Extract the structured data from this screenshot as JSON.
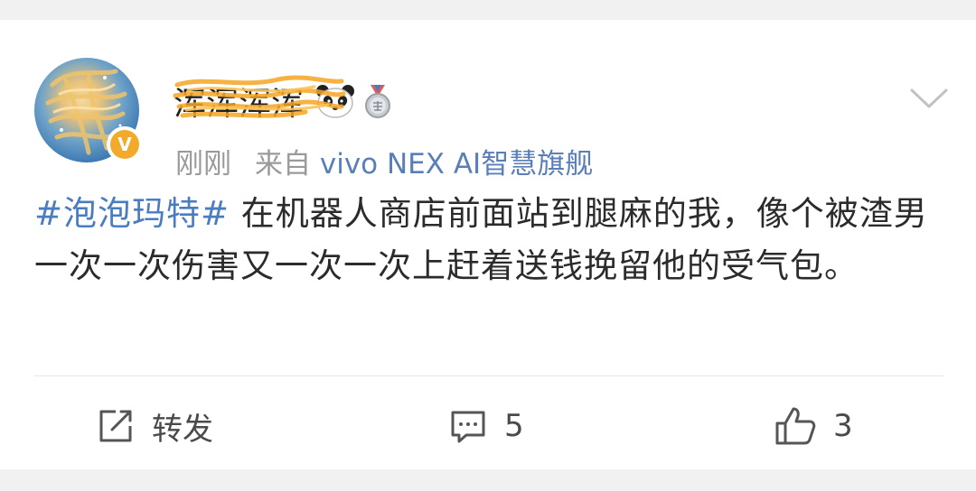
{
  "post": {
    "user": {
      "name": "浑浑浑浑",
      "avatar_icon": "avatar-image",
      "verified_icon": "verified-v-icon",
      "verified_mark": "V",
      "badges": [
        "panda-icon",
        "medal-icon"
      ]
    },
    "time": "刚刚",
    "source_prefix": "来自",
    "source_device": "vivo NEX AI智慧旗舰",
    "hashtag": "#泡泡玛特#",
    "body": " 在机器人商店前面站到腿麻的我，像个被渣男一次一次伤害又一次一次上赶着送钱挽留他的受气包。"
  },
  "actions": {
    "repost_label": "转发",
    "comment_count": "5",
    "like_count": "3"
  },
  "colors": {
    "hashtag": "#4a7cc1",
    "verified": "#f3a92a",
    "meta_text": "#9a9a9a"
  }
}
